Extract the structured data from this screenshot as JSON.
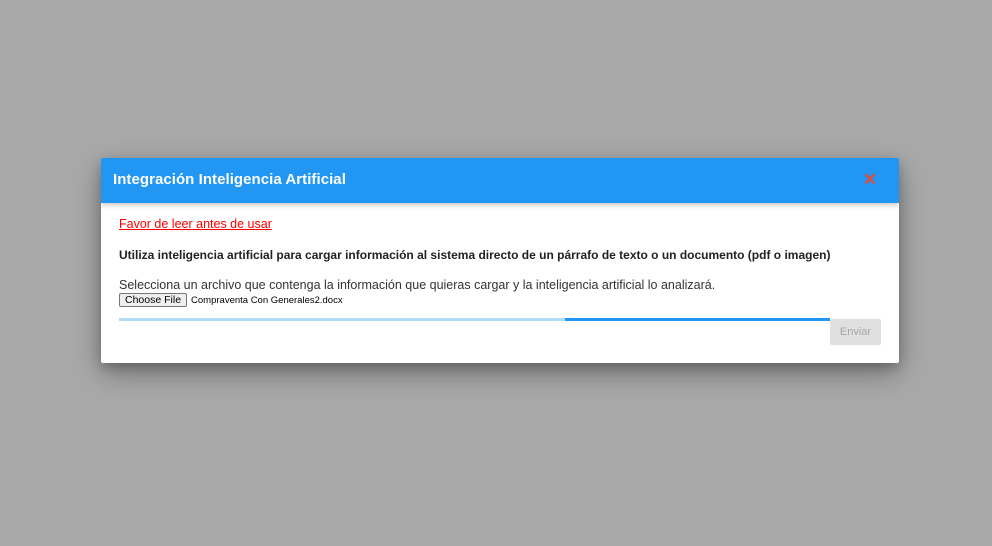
{
  "dialog": {
    "title": "Integración Inteligencia Artificial",
    "close_icon": "close-icon",
    "help_link": "Favor de leer antes de usar",
    "description": "Utiliza inteligencia artificial para cargar información al sistema directo de un párrafo de texto o un documento (pdf o imagen)",
    "instruction": "Selecciona un archivo que contenga la información que quieras cargar y la inteligencia artificial lo analizará.",
    "file_input": {
      "button_label": "Choose File",
      "selected_file": "Compraventa Con Generales2.docx"
    },
    "progress": {
      "state": "indeterminate"
    },
    "submit_label": "Enviar"
  },
  "colors": {
    "overlay": "#a9a9a9",
    "header": "#2196f3",
    "close": "#e24a3b",
    "link": "#ff0000",
    "progress_track": "#b3dcf9",
    "progress_fill": "#2196f3",
    "disabled_button": "#e0e0e0"
  }
}
